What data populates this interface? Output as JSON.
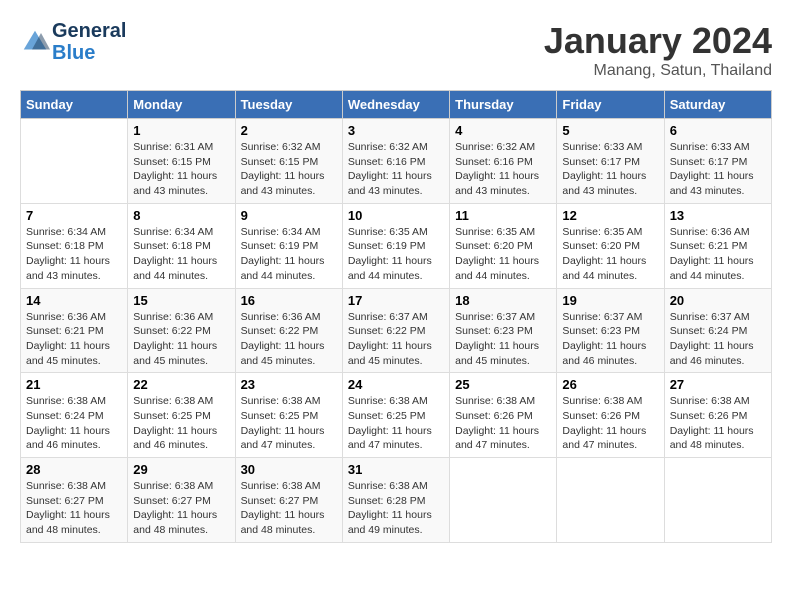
{
  "header": {
    "logo_line1": "General",
    "logo_line2": "Blue",
    "month": "January 2024",
    "location": "Manang, Satun, Thailand"
  },
  "weekdays": [
    "Sunday",
    "Monday",
    "Tuesday",
    "Wednesday",
    "Thursday",
    "Friday",
    "Saturday"
  ],
  "weeks": [
    [
      {
        "day": null
      },
      {
        "day": 1,
        "sunrise": "6:31 AM",
        "sunset": "6:15 PM",
        "daylight": "11 hours and 43 minutes."
      },
      {
        "day": 2,
        "sunrise": "6:32 AM",
        "sunset": "6:15 PM",
        "daylight": "11 hours and 43 minutes."
      },
      {
        "day": 3,
        "sunrise": "6:32 AM",
        "sunset": "6:16 PM",
        "daylight": "11 hours and 43 minutes."
      },
      {
        "day": 4,
        "sunrise": "6:32 AM",
        "sunset": "6:16 PM",
        "daylight": "11 hours and 43 minutes."
      },
      {
        "day": 5,
        "sunrise": "6:33 AM",
        "sunset": "6:17 PM",
        "daylight": "11 hours and 43 minutes."
      },
      {
        "day": 6,
        "sunrise": "6:33 AM",
        "sunset": "6:17 PM",
        "daylight": "11 hours and 43 minutes."
      }
    ],
    [
      {
        "day": 7,
        "sunrise": "6:34 AM",
        "sunset": "6:18 PM",
        "daylight": "11 hours and 43 minutes."
      },
      {
        "day": 8,
        "sunrise": "6:34 AM",
        "sunset": "6:18 PM",
        "daylight": "11 hours and 44 minutes."
      },
      {
        "day": 9,
        "sunrise": "6:34 AM",
        "sunset": "6:19 PM",
        "daylight": "11 hours and 44 minutes."
      },
      {
        "day": 10,
        "sunrise": "6:35 AM",
        "sunset": "6:19 PM",
        "daylight": "11 hours and 44 minutes."
      },
      {
        "day": 11,
        "sunrise": "6:35 AM",
        "sunset": "6:20 PM",
        "daylight": "11 hours and 44 minutes."
      },
      {
        "day": 12,
        "sunrise": "6:35 AM",
        "sunset": "6:20 PM",
        "daylight": "11 hours and 44 minutes."
      },
      {
        "day": 13,
        "sunrise": "6:36 AM",
        "sunset": "6:21 PM",
        "daylight": "11 hours and 44 minutes."
      }
    ],
    [
      {
        "day": 14,
        "sunrise": "6:36 AM",
        "sunset": "6:21 PM",
        "daylight": "11 hours and 45 minutes."
      },
      {
        "day": 15,
        "sunrise": "6:36 AM",
        "sunset": "6:22 PM",
        "daylight": "11 hours and 45 minutes."
      },
      {
        "day": 16,
        "sunrise": "6:36 AM",
        "sunset": "6:22 PM",
        "daylight": "11 hours and 45 minutes."
      },
      {
        "day": 17,
        "sunrise": "6:37 AM",
        "sunset": "6:22 PM",
        "daylight": "11 hours and 45 minutes."
      },
      {
        "day": 18,
        "sunrise": "6:37 AM",
        "sunset": "6:23 PM",
        "daylight": "11 hours and 45 minutes."
      },
      {
        "day": 19,
        "sunrise": "6:37 AM",
        "sunset": "6:23 PM",
        "daylight": "11 hours and 46 minutes."
      },
      {
        "day": 20,
        "sunrise": "6:37 AM",
        "sunset": "6:24 PM",
        "daylight": "11 hours and 46 minutes."
      }
    ],
    [
      {
        "day": 21,
        "sunrise": "6:38 AM",
        "sunset": "6:24 PM",
        "daylight": "11 hours and 46 minutes."
      },
      {
        "day": 22,
        "sunrise": "6:38 AM",
        "sunset": "6:25 PM",
        "daylight": "11 hours and 46 minutes."
      },
      {
        "day": 23,
        "sunrise": "6:38 AM",
        "sunset": "6:25 PM",
        "daylight": "11 hours and 47 minutes."
      },
      {
        "day": 24,
        "sunrise": "6:38 AM",
        "sunset": "6:25 PM",
        "daylight": "11 hours and 47 minutes."
      },
      {
        "day": 25,
        "sunrise": "6:38 AM",
        "sunset": "6:26 PM",
        "daylight": "11 hours and 47 minutes."
      },
      {
        "day": 26,
        "sunrise": "6:38 AM",
        "sunset": "6:26 PM",
        "daylight": "11 hours and 47 minutes."
      },
      {
        "day": 27,
        "sunrise": "6:38 AM",
        "sunset": "6:26 PM",
        "daylight": "11 hours and 48 minutes."
      }
    ],
    [
      {
        "day": 28,
        "sunrise": "6:38 AM",
        "sunset": "6:27 PM",
        "daylight": "11 hours and 48 minutes."
      },
      {
        "day": 29,
        "sunrise": "6:38 AM",
        "sunset": "6:27 PM",
        "daylight": "11 hours and 48 minutes."
      },
      {
        "day": 30,
        "sunrise": "6:38 AM",
        "sunset": "6:27 PM",
        "daylight": "11 hours and 48 minutes."
      },
      {
        "day": 31,
        "sunrise": "6:38 AM",
        "sunset": "6:28 PM",
        "daylight": "11 hours and 49 minutes."
      },
      {
        "day": null
      },
      {
        "day": null
      },
      {
        "day": null
      }
    ]
  ],
  "labels": {
    "sunrise": "Sunrise:",
    "sunset": "Sunset:",
    "daylight": "Daylight:"
  }
}
